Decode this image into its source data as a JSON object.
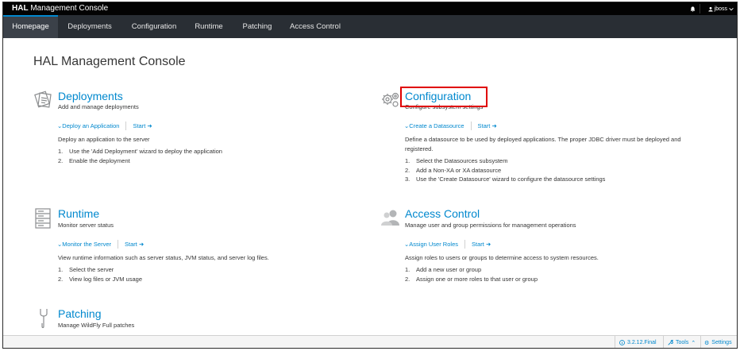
{
  "app": {
    "brand_bold": "HAL",
    "brand_rest": " Management Console",
    "user": "jboss"
  },
  "nav": {
    "tabs": [
      {
        "label": "Homepage"
      },
      {
        "label": "Deployments"
      },
      {
        "label": "Configuration"
      },
      {
        "label": "Runtime"
      },
      {
        "label": "Patching"
      },
      {
        "label": "Access Control"
      }
    ]
  },
  "page": {
    "title": "HAL Management Console"
  },
  "cards": {
    "deployments": {
      "icon": "deployments-icon",
      "title": "Deployments",
      "subtitle": "Add and manage deployments",
      "action": "Deploy an Application",
      "start": "Start",
      "desc": "Deploy an application to the server",
      "steps": [
        "Use the 'Add Deployment' wizard to deploy the application",
        "Enable the deployment"
      ]
    },
    "configuration": {
      "icon": "gears-icon",
      "title": "Configuration",
      "subtitle": "Configure subsystem settings",
      "action": "Create a Datasource",
      "start": "Start",
      "desc": "Define a datasource to be used by deployed applications. The proper JDBC driver must be deployed and registered.",
      "steps": [
        "Select the Datasources subsystem",
        "Add a Non-XA or XA datasource",
        "Use the 'Create Datasource' wizard to configure the datasource settings"
      ]
    },
    "runtime": {
      "icon": "server-icon",
      "title": "Runtime",
      "subtitle": "Monitor server status",
      "action": "Monitor the Server",
      "start": "Start",
      "desc": "View runtime information such as server status, JVM status, and server log files.",
      "steps": [
        "Select the server",
        "View log files or JVM usage"
      ]
    },
    "access": {
      "icon": "users-icon",
      "title": "Access Control",
      "subtitle": "Manage user and group permissions for management operations",
      "action": "Assign User Roles",
      "start": "Start",
      "desc": "Assign roles to users or groups to determine access to system resources.",
      "steps": [
        "Add a new user or group",
        "Assign one or more roles to that user or group"
      ]
    },
    "patching": {
      "icon": "bandage-icon",
      "title": "Patching",
      "subtitle": "Manage WildFly Full patches"
    }
  },
  "footer": {
    "version": "3.2.12.Final",
    "tools": "Tools",
    "settings": "Settings"
  },
  "colors": {
    "link": "#0088ce",
    "nav_bg": "#292e34",
    "topbar_bg": "#030303",
    "highlight": "#e00000"
  }
}
